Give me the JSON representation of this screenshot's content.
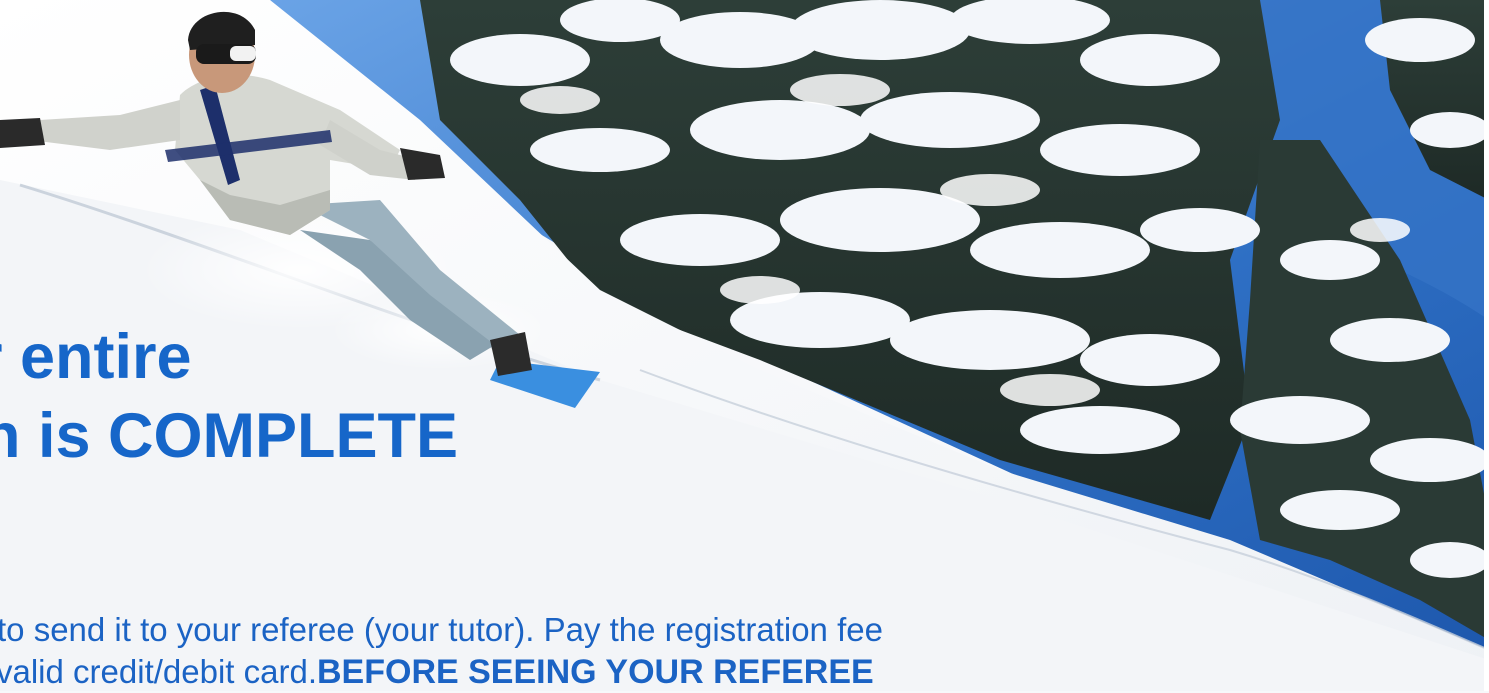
{
  "headline": {
    "line1": "r entire",
    "line2": "n is COMPLETE"
  },
  "body": {
    "line1": "to send it to your referee (your tutor). Pay the registration fee",
    "line2_regular": "valid credit/debit card.",
    "line2_bold": "BEFORE SEEING YOUR REFEREE"
  },
  "colors": {
    "text_blue": "#1666c9",
    "sky": "#3f7fd2",
    "snow": "#f4f6f9"
  },
  "image": {
    "subject": "snowboarder carving down a snowy slope beside snow-covered pine trees under a blue sky"
  }
}
